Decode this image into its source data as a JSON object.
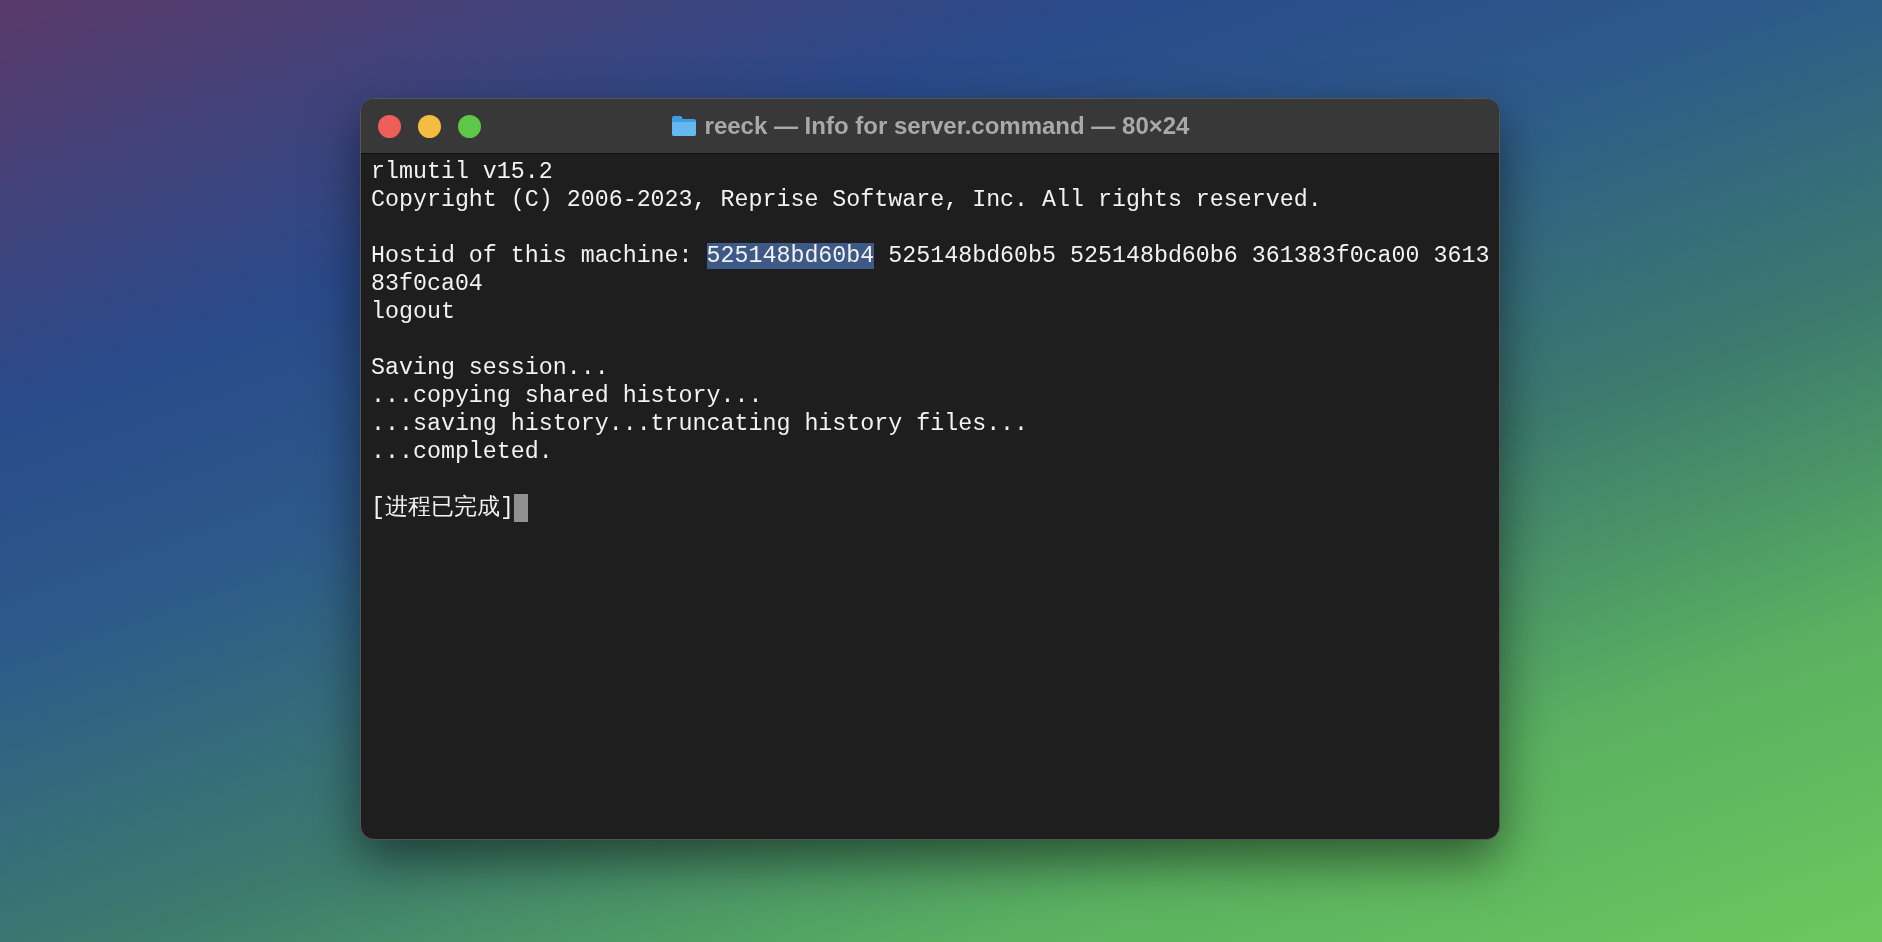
{
  "window": {
    "title": "reeck — Info for server.command — 80×24"
  },
  "terminal": {
    "blocks": [
      [
        {
          "segments": [
            {
              "text": "rlmutil v15.2",
              "selected": false
            }
          ]
        },
        {
          "segments": [
            {
              "text": "Copyright (C) 2006-2023, Reprise Software, Inc. All rights reserved.",
              "selected": false
            }
          ]
        }
      ],
      [
        {
          "segments": [
            {
              "text": "Hostid of this machine: ",
              "selected": false
            },
            {
              "text": "525148bd60b4",
              "selected": true
            },
            {
              "text": " 525148bd60b5 525148bd60b6 361383f0ca00 3613",
              "selected": false
            }
          ]
        },
        {
          "segments": [
            {
              "text": "83f0ca04",
              "selected": false
            }
          ]
        },
        {
          "segments": [
            {
              "text": "logout",
              "selected": false
            }
          ]
        }
      ],
      [
        {
          "segments": [
            {
              "text": "Saving session...",
              "selected": false
            }
          ]
        },
        {
          "segments": [
            {
              "text": "...copying shared history...",
              "selected": false
            }
          ]
        },
        {
          "segments": [
            {
              "text": "...saving history...truncating history files...",
              "selected": false
            }
          ]
        },
        {
          "segments": [
            {
              "text": "...completed.",
              "selected": false
            }
          ]
        }
      ],
      [
        {
          "segments": [
            {
              "text": "[进程已完成]",
              "selected": false
            }
          ],
          "cursor": true
        }
      ]
    ]
  }
}
